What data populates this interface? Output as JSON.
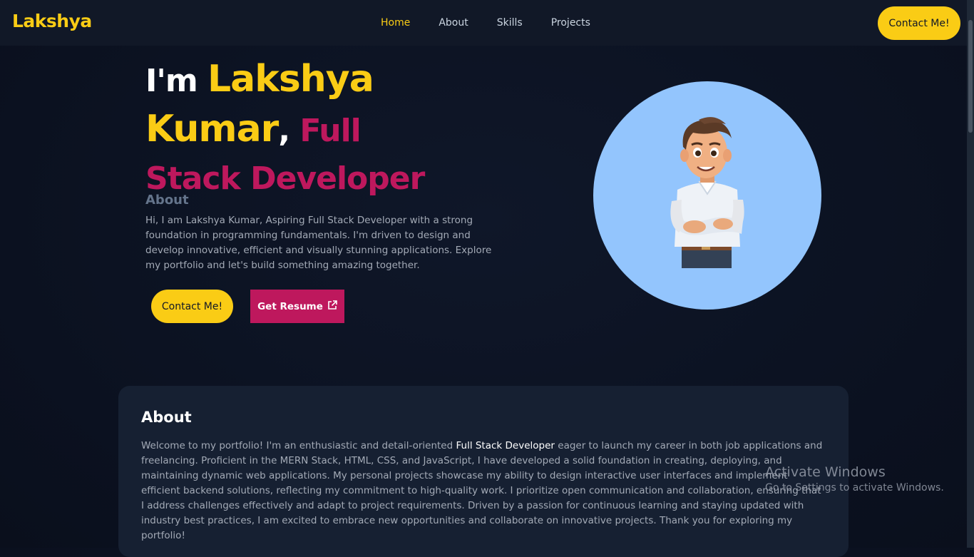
{
  "nav": {
    "logo": "Lakshya",
    "links": [
      "Home",
      "About",
      "Skills",
      "Projects"
    ],
    "contact_label": "Contact Me!"
  },
  "hero": {
    "prefix": "I'm ",
    "name_first": "Lakshya",
    "name_last": "Kumar",
    "comma": ", ",
    "role_1": "Full",
    "role_2": "Stack Developer",
    "about_heading": "About",
    "about_text": "Hi, I am Lakshya Kumar, Aspiring Full Stack Developer with a strong foundation in programming fundamentals. I'm driven to design and develop innovative, efficient and visually stunning applications. Explore my portfolio and let's build something amazing together.",
    "contact_button": "Contact Me!",
    "resume_button": "Get Resume"
  },
  "about_section": {
    "heading": "About",
    "text_before": "Welcome to my portfolio! I'm an enthusiastic and detail-oriented ",
    "highlight": "Full Stack Developer",
    "text_after": " eager to launch my career in both job applications and freelancing. Proficient in the MERN Stack, HTML, CSS, and JavaScript, I have developed a solid foundation in creating, deploying, and maintaining dynamic web applications. My personal projects showcase my ability to design interactive user interfaces and implement efficient backend solutions, reflecting my commitment to high-quality work. I prioritize open communication and collaboration, ensuring that I address challenges effectively and adapt to project requirements. Driven by a passion for continuous learning and staying updated with industry best practices, I am excited to embrace new opportunities and collaborate on innovative projects. Thank you for exploring my portfolio!"
  },
  "watermark": {
    "line1": "Activate Windows",
    "line2": "Go to Settings to activate Windows."
  },
  "colors": {
    "accent_yellow": "#facc15",
    "accent_pink": "#be185d",
    "avatar_bg": "#93c5fd"
  }
}
